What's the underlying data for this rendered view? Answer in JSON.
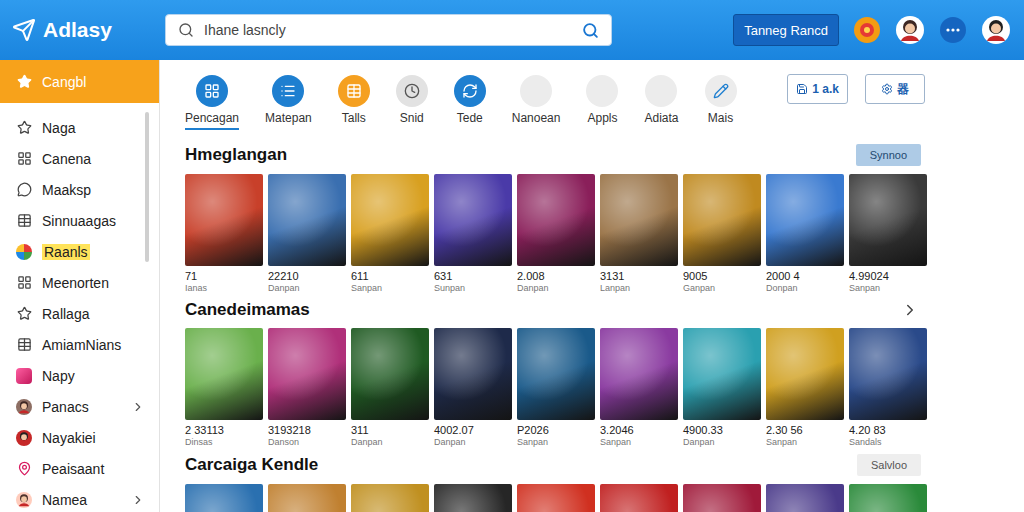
{
  "app": {
    "logo": "Adlasy",
    "search_placeholder": "Ihane lasncly",
    "action_button": "Tanneg Rancd"
  },
  "sidebar": {
    "items": [
      {
        "label": "Cangbl",
        "selected": true,
        "highlighted": false,
        "expandable": false
      },
      {
        "label": "Naga",
        "selected": false,
        "highlighted": false,
        "expandable": false
      },
      {
        "label": "Canena",
        "selected": false,
        "highlighted": false,
        "expandable": false
      },
      {
        "label": "Maaksp",
        "selected": false,
        "highlighted": false,
        "expandable": false
      },
      {
        "label": "Sinnuaagas",
        "selected": false,
        "highlighted": false,
        "expandable": false
      },
      {
        "label": "Raanls",
        "selected": false,
        "highlighted": true,
        "expandable": false
      },
      {
        "label": "Meenorten",
        "selected": false,
        "highlighted": false,
        "expandable": false
      },
      {
        "label": "Rallaga",
        "selected": false,
        "highlighted": false,
        "expandable": false
      },
      {
        "label": "AmiamNians",
        "selected": false,
        "highlighted": false,
        "expandable": false
      },
      {
        "label": "Napy",
        "selected": false,
        "highlighted": false,
        "expandable": false
      },
      {
        "label": "Panacs",
        "selected": false,
        "highlighted": false,
        "expandable": true
      },
      {
        "label": "Nayakiei",
        "selected": false,
        "highlighted": false,
        "expandable": false
      },
      {
        "label": "Peaisaant",
        "selected": false,
        "highlighted": false,
        "expandable": false
      },
      {
        "label": "Namea",
        "selected": false,
        "highlighted": false,
        "expandable": true
      }
    ]
  },
  "categories": [
    {
      "label": "Pencagan",
      "selected": true,
      "color": "#1e7fd0"
    },
    {
      "label": "Matepan",
      "selected": false,
      "color": "#1e7fd0"
    },
    {
      "label": "Talls",
      "selected": false,
      "color": "#f5a020"
    },
    {
      "label": "Snid",
      "selected": false,
      "color": "#e2e2e2"
    },
    {
      "label": "Tede",
      "selected": false,
      "color": "#1e7fd0"
    },
    {
      "label": "Nanoean",
      "selected": false,
      "color": "#ececec"
    },
    {
      "label": "Appls",
      "selected": false,
      "color": "#ececec"
    },
    {
      "label": "Adiata",
      "selected": false,
      "color": "#ececec"
    },
    {
      "label": "Mais",
      "selected": false,
      "color": "#ececec"
    }
  ],
  "view_buttons": [
    "1 a.k",
    "器"
  ],
  "sections": [
    {
      "title": "Hmeglangan",
      "kind": "button",
      "button": "Synnoo",
      "cards": [
        {
          "count": "71",
          "sub": "Ianas",
          "color": "#c8402a"
        },
        {
          "count": "22210",
          "sub": "Danpan",
          "color": "#3a6fb0"
        },
        {
          "count": "611",
          "sub": "Sanpan",
          "color": "#d8a020"
        },
        {
          "count": "631",
          "sub": "Sunpan",
          "color": "#4a3aa8"
        },
        {
          "count": "2.008",
          "sub": "Danpan",
          "color": "#8a1f5a"
        },
        {
          "count": "3131",
          "sub": "Lanpan",
          "color": "#9a7448"
        },
        {
          "count": "9005",
          "sub": "Ganpan",
          "color": "#c08a20"
        },
        {
          "count": "2000 4",
          "sub": "Donpan",
          "color": "#3a7ad0"
        },
        {
          "count": "4.99024",
          "sub": "Sanpan",
          "color": "#3a3a3a"
        }
      ]
    },
    {
      "title": "Canedeimamas",
      "kind": "chevron",
      "cards": [
        {
          "count": "2 33113",
          "sub": "Dinsas",
          "color": "#6ab04c"
        },
        {
          "count": "3193218",
          "sub": "Danson",
          "color": "#b0307a"
        },
        {
          "count": "311",
          "sub": "Danpan",
          "color": "#1f5a22"
        },
        {
          "count": "4002.07",
          "sub": "Danpan",
          "color": "#1e2a4a"
        },
        {
          "count": "P2026",
          "sub": "Sanpan",
          "color": "#1a5a8a"
        },
        {
          "count": "3.2046",
          "sub": "Sanpan",
          "color": "#8a3aa0"
        },
        {
          "count": "4900.33",
          "sub": "Danpan",
          "color": "#2aa0b0"
        },
        {
          "count": "2.30 56",
          "sub": "Sanpan",
          "color": "#d0a020"
        },
        {
          "count": "4.20 83",
          "sub": "Sandals",
          "color": "#2a4a8a"
        }
      ]
    },
    {
      "title": "Carcaiga Kendle",
      "kind": "button",
      "button": "Salvloo",
      "cards": [
        {
          "color": "#2a70b0"
        },
        {
          "color": "#c08030"
        },
        {
          "color": "#c09020"
        },
        {
          "color": "#262626"
        },
        {
          "color": "#d03020"
        },
        {
          "color": "#c02020"
        },
        {
          "color": "#a01a3a"
        },
        {
          "color": "#4a3a8a"
        },
        {
          "color": "#2a8a3a"
        }
      ]
    }
  ]
}
